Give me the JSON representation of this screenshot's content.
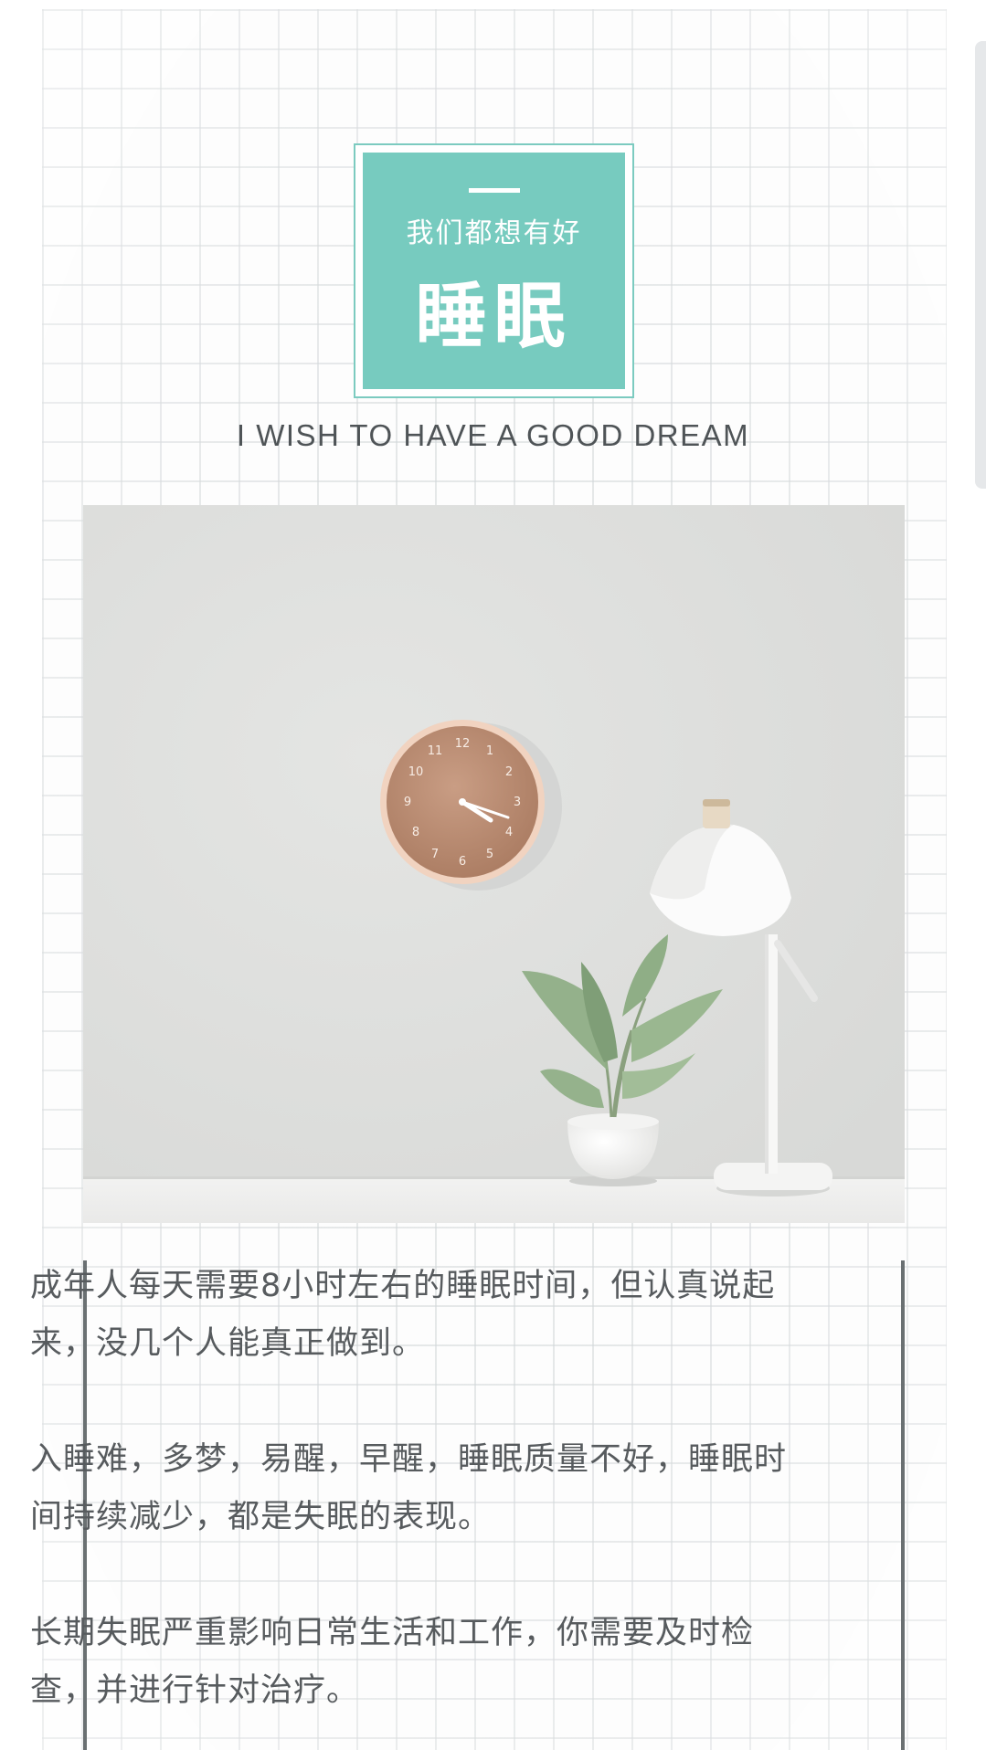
{
  "header": {
    "subtitle": "我们都想有好",
    "title": "睡眠",
    "tagline": "I WISH TO HAVE A GOOD DREAM"
  },
  "photo": {
    "description_icon": "photo-clock-plant-lamp",
    "clock_numbers": [
      "12",
      "1",
      "2",
      "3",
      "4",
      "5",
      "6",
      "7",
      "8",
      "9",
      "10",
      "11"
    ]
  },
  "body": {
    "paragraphs": [
      "成年人每天需要8小时左右的睡眠时间，但认真说起来，没几个人能真正做到。",
      "入睡难，多梦，易醒，早醒，睡眠质量不好，睡眠时间持续减少，都是失眠的表现。",
      "长期失眠严重影响日常生活和工作，你需要及时检查，并进行针对治疗。"
    ]
  },
  "colors": {
    "accent": "#77cbbf",
    "text": "#575b5e",
    "frame": "#6a7072"
  }
}
